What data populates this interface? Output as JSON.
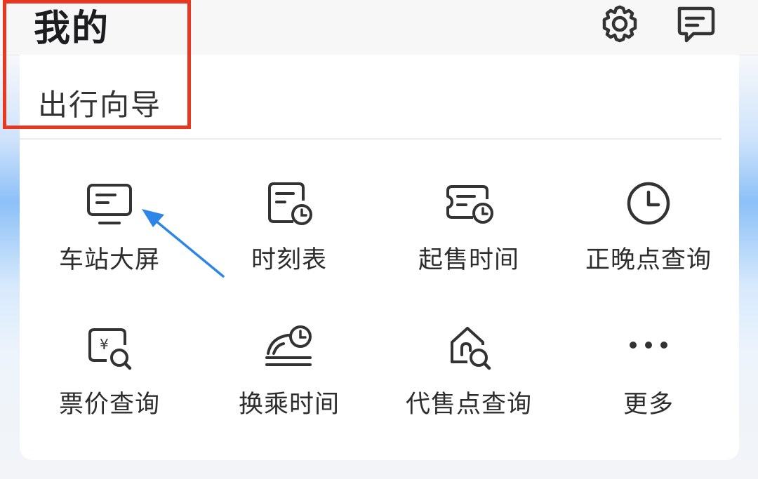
{
  "header": {
    "title": "我的",
    "icons": [
      "gear-icon",
      "message-icon"
    ]
  },
  "section": {
    "title": "出行向导"
  },
  "grid": {
    "items": [
      {
        "label": "车站大屏",
        "icon": "station-screen-icon"
      },
      {
        "label": "时刻表",
        "icon": "timetable-icon"
      },
      {
        "label": "起售时间",
        "icon": "ticket-sale-time-icon"
      },
      {
        "label": "正晚点查询",
        "icon": "clock-icon"
      },
      {
        "label": "票价查询",
        "icon": "fare-search-icon"
      },
      {
        "label": "换乘时间",
        "icon": "transfer-time-icon"
      },
      {
        "label": "代售点查询",
        "icon": "agency-search-icon"
      },
      {
        "label": "更多",
        "icon": "more-dots-icon"
      }
    ]
  },
  "colors": {
    "highlight": "#e8361f",
    "arrow": "#2b86e8",
    "icon_stroke": "#333333"
  }
}
